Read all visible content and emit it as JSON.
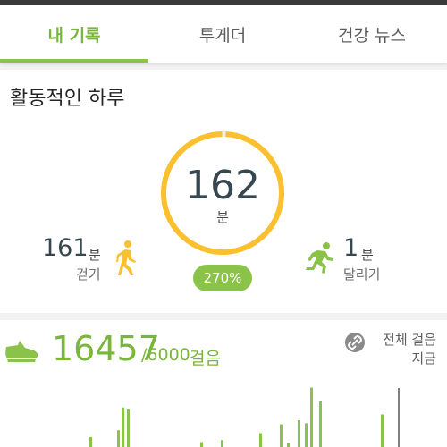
{
  "tabs": [
    {
      "label": "내 기록",
      "active": true
    },
    {
      "label": "투게더",
      "active": false
    },
    {
      "label": "건강 뉴스",
      "active": false
    }
  ],
  "colors": {
    "accent_green": "#8bc34a",
    "ring_orange": "#fbc02d",
    "text_dark": "#37474f"
  },
  "activity": {
    "title": "활동적인 하루",
    "total_minutes": "162",
    "minutes_unit": "분",
    "goal_percent": "270%",
    "ring_progress": 0.99,
    "walking": {
      "value": "161",
      "unit": "분",
      "label": "걷기",
      "icon": "walking-icon"
    },
    "running": {
      "value": "1",
      "unit": "분",
      "label": "달리기",
      "icon": "running-icon"
    }
  },
  "steps": {
    "icon": "shoe-icon",
    "count": "16457",
    "goal": "/6000",
    "unit": "걸음",
    "link_icon": "link-icon",
    "link_line1": "전체 걸음",
    "link_line2": "지금"
  },
  "chart_data": {
    "type": "bar",
    "title": "",
    "xlabel": "",
    "ylabel": "",
    "values": [
      0,
      0,
      0,
      0,
      0,
      0,
      0,
      0,
      0,
      0,
      0,
      0,
      0,
      0,
      0,
      0,
      0,
      0,
      0,
      0,
      0,
      0,
      0,
      0,
      0,
      0,
      0,
      0,
      0,
      0,
      0,
      0,
      0,
      0,
      0,
      0,
      0,
      0,
      0,
      0,
      0,
      0,
      0,
      0,
      0,
      0,
      0,
      0,
      0,
      0,
      0,
      0,
      0,
      0,
      0,
      0,
      0,
      0,
      0,
      0,
      0,
      0,
      0,
      0,
      0,
      0,
      0,
      0,
      0,
      0,
      0,
      0,
      0,
      0,
      0,
      0,
      0,
      0,
      0,
      0,
      0,
      0,
      0,
      0,
      0,
      0,
      0,
      0,
      0,
      0,
      0,
      0,
      0,
      0,
      0,
      0,
      0,
      0,
      0,
      0,
      0,
      0,
      0,
      0,
      0,
      0,
      0,
      0,
      0,
      0,
      0,
      0,
      0,
      0,
      0,
      0,
      0,
      0,
      0,
      0,
      0,
      0,
      0,
      0,
      0,
      0,
      0,
      0,
      0,
      0,
      0,
      0,
      0,
      0,
      0,
      0,
      0,
      0,
      0,
      0,
      0,
      0,
      0,
      0,
      0,
      0,
      0,
      0,
      0,
      0,
      0,
      0,
      0,
      0,
      0,
      0,
      0,
      0,
      0,
      0,
      0,
      0,
      0,
      0,
      0,
      0,
      0,
      0,
      0,
      0,
      0,
      0,
      0,
      0,
      0,
      0,
      0,
      0,
      0,
      0,
      0,
      0,
      0,
      0,
      0,
      0,
      0,
      0,
      0,
      0,
      0,
      0,
      0,
      0,
      0,
      0,
      0,
      0,
      0,
      0,
      0,
      0,
      0,
      0,
      0,
      0,
      0,
      0,
      0,
      0,
      0,
      0,
      0,
      0,
      0,
      0,
      0,
      0,
      0,
      0,
      0,
      0,
      0,
      0,
      0,
      0,
      0,
      0,
      0,
      0,
      0,
      0,
      0,
      0,
      0,
      0,
      0,
      0,
      0,
      0,
      0,
      0,
      0,
      0,
      0,
      0
    ],
    "bars": [
      {
        "x": 100,
        "v": 10
      },
      {
        "x": 131,
        "v": 17
      },
      {
        "x": 136,
        "v": 40
      },
      {
        "x": 142,
        "v": 38
      },
      {
        "x": 224,
        "v": 5
      },
      {
        "x": 247,
        "v": 7
      },
      {
        "x": 290,
        "v": 14
      },
      {
        "x": 313,
        "v": 23
      },
      {
        "x": 321,
        "v": 4
      },
      {
        "x": 333,
        "v": 27
      },
      {
        "x": 341,
        "v": 24
      },
      {
        "x": 347,
        "v": 60
      },
      {
        "x": 357,
        "v": 46
      },
      {
        "x": 426,
        "v": 33
      }
    ],
    "ylim": [
      0,
      65
    ],
    "current_time_marker": true
  }
}
